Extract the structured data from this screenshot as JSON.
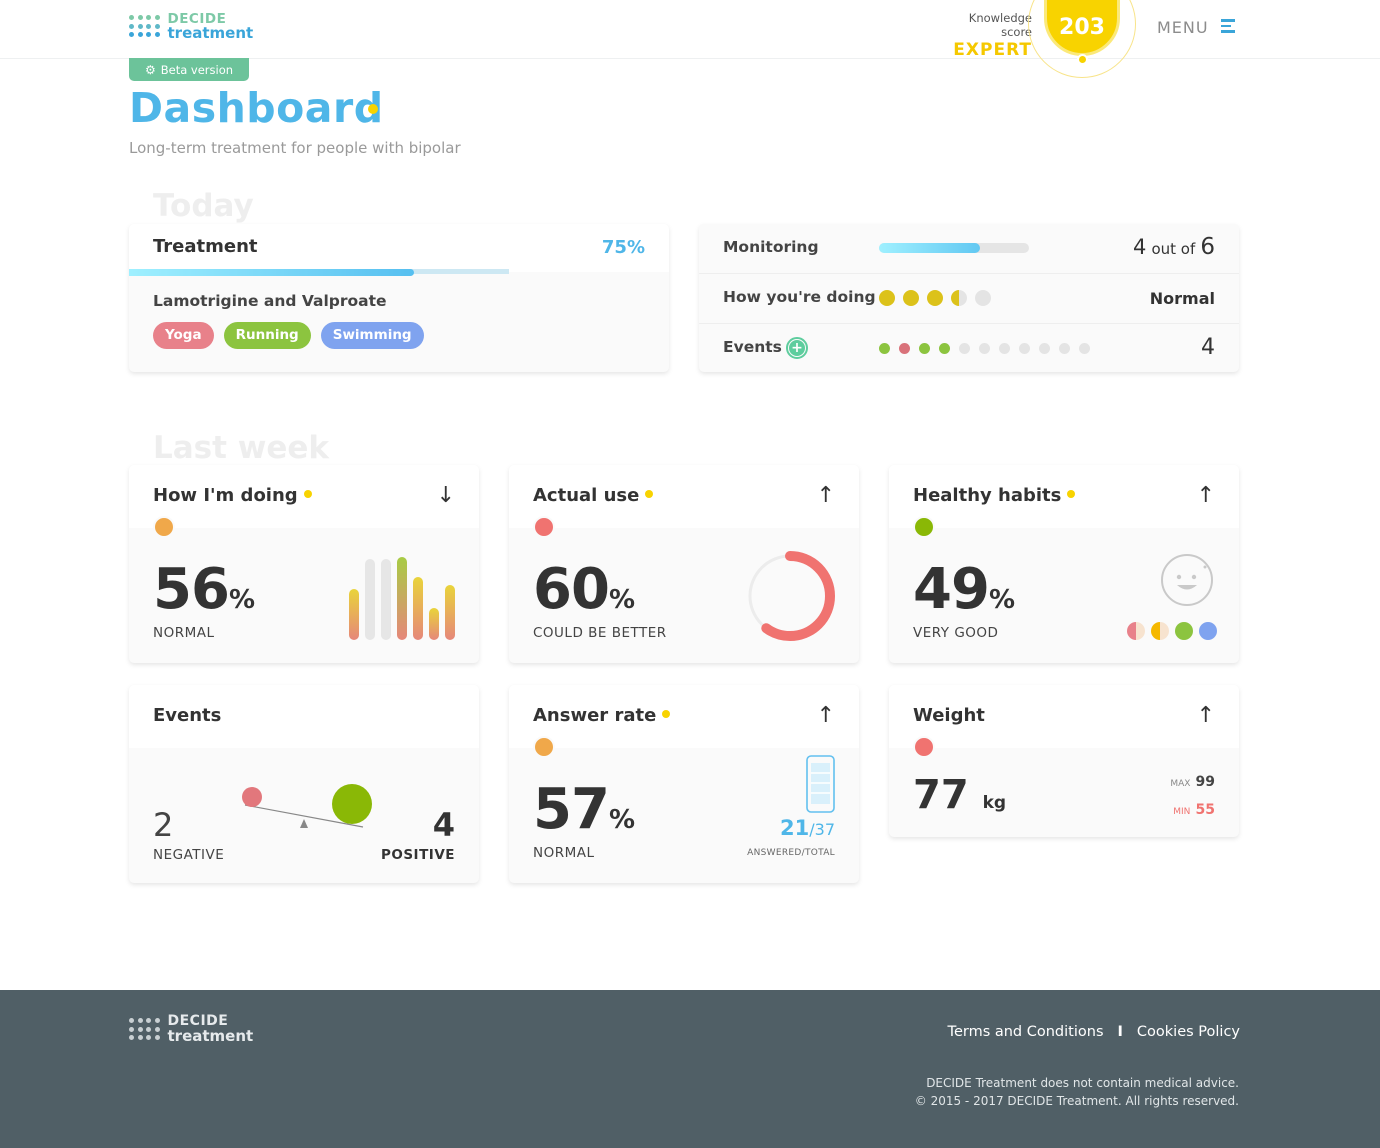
{
  "header": {
    "logo_line1": "DECIDE",
    "logo_line2": "treatment",
    "knowledge_label": "Knowledge score",
    "knowledge_level": "EXPERT",
    "knowledge_score": "203",
    "menu_label": "MENU"
  },
  "beta": {
    "label": "Beta version"
  },
  "page": {
    "title": "Dashboard",
    "subtitle": "Long-term treatment for people with bipolar"
  },
  "today": {
    "label": "Today",
    "treatment": {
      "title": "Treatment",
      "percent": "75%",
      "progress": 0.75,
      "drug": "Lamotrigine and Valproate",
      "activities": [
        {
          "label": "Yoga",
          "color": "#e8818a"
        },
        {
          "label": "Running",
          "color": "#8cc43f"
        },
        {
          "label": "Swimming",
          "color": "#7fa3ef"
        }
      ]
    },
    "monitoring": {
      "label": "Monitoring",
      "progress": 0.67,
      "count": "4",
      "of_label": "out of",
      "total": "6",
      "doing_label": "How you're doing",
      "doing_value": "Normal",
      "doing_dots": [
        "full",
        "full",
        "full",
        "half",
        "empty"
      ],
      "events_label": "Events",
      "events_value": "4",
      "events_dots": [
        "#8cc43f",
        "#d9727a",
        "#8cc43f",
        "#8cc43f",
        "e",
        "e",
        "e",
        "e",
        "e",
        "e",
        "e"
      ]
    }
  },
  "last_week": {
    "label": "Last week",
    "doing": {
      "title": "How I'm doing",
      "arrow": "↓",
      "value": "56",
      "unit": "%",
      "caption": "NORMAL",
      "status_color": "#f0a84a",
      "bars": [
        0.55,
        0.88,
        0.88,
        0.9,
        0.68,
        0.35,
        0.6
      ]
    },
    "actual_use": {
      "title": "Actual use",
      "arrow": "↑",
      "value": "60",
      "unit": "%",
      "caption": "COULD BE BETTER",
      "status_color": "#f07370",
      "fraction": 0.6
    },
    "habits": {
      "title": "Healthy habits",
      "arrow": "↑",
      "value": "49",
      "unit": "%",
      "caption": "VERY GOOD",
      "status_color": "#8ab806",
      "habit_dots": [
        "#e8818a",
        "#f5b800",
        "#8cc43f",
        "#7fa3ef"
      ]
    },
    "events": {
      "title": "Events",
      "negative_value": "2",
      "negative_label": "NEGATIVE",
      "positive_value": "4",
      "positive_label": "POSITIVE"
    },
    "answer_rate": {
      "title": "Answer rate",
      "arrow": "↑",
      "value": "57",
      "unit": "%",
      "caption": "NORMAL",
      "status_color": "#f0a84a",
      "answered": "21",
      "total": "/37",
      "answered_label": "ANSWERED/TOTAL"
    },
    "weight": {
      "title": "Weight",
      "arrow": "↑",
      "value": "77",
      "unit": "kg",
      "status_color": "#f07370",
      "max_label": "MAX",
      "max_value": "99",
      "min_label": "MIN",
      "min_value": "55"
    }
  },
  "footer": {
    "logo_line1": "DECIDE",
    "logo_line2": "treatment",
    "terms": "Terms and Conditions",
    "separator": "I",
    "cookies": "Cookies Policy",
    "disclaimer": "DECIDE Treatment does not contain medical advice.",
    "copyright": "© 2015 - 2017 DECIDE Treatment. All rights reserved."
  }
}
